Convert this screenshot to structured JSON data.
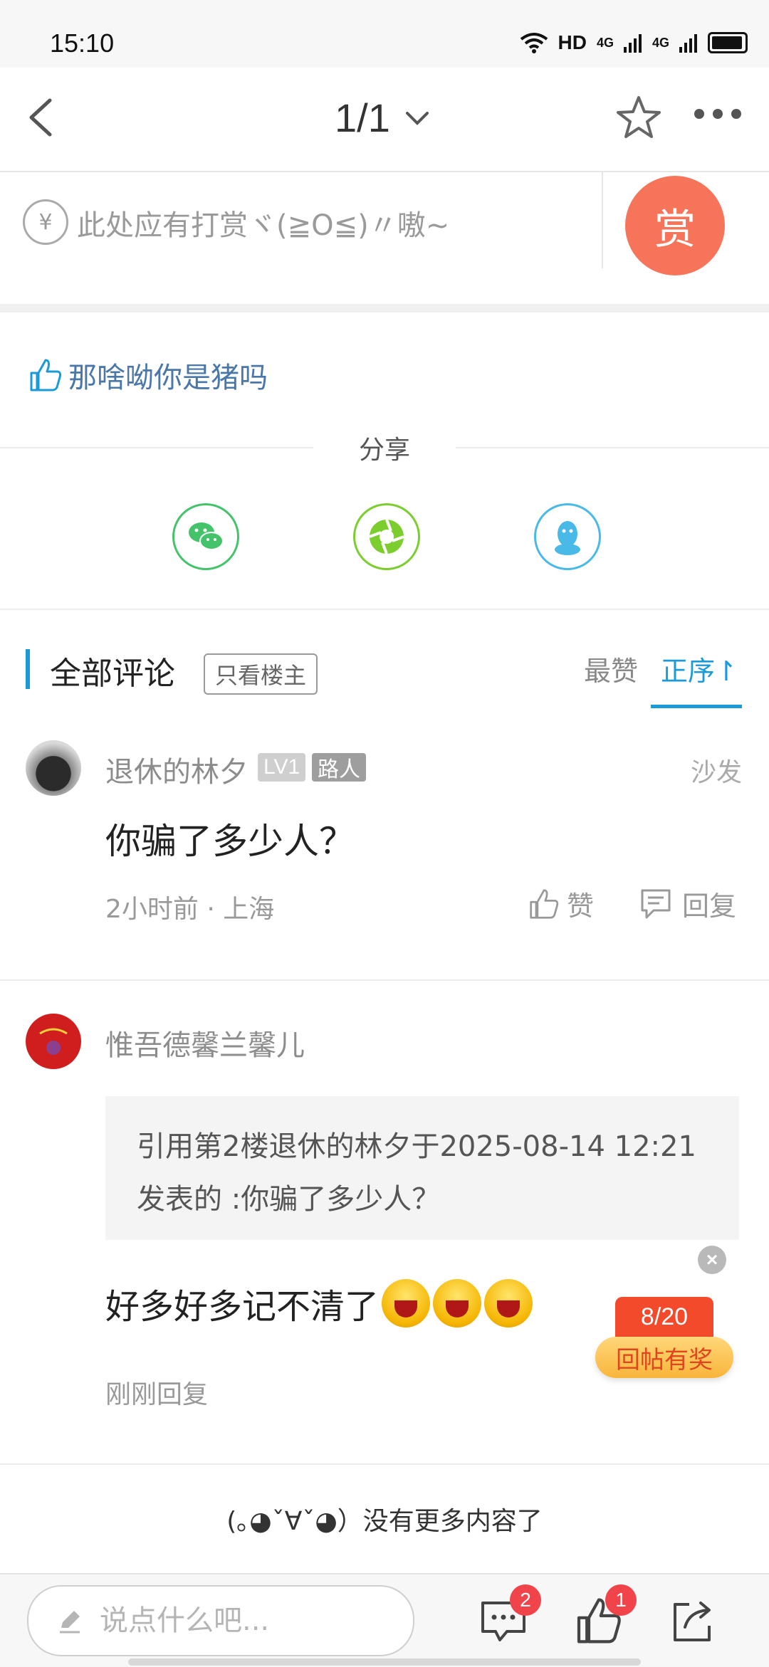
{
  "status_bar": {
    "time": "15:10",
    "network": "HD",
    "signal1": "4G",
    "signal2": "4G"
  },
  "top_nav": {
    "page_indicator": "1/1"
  },
  "reward": {
    "yen_symbol": "¥",
    "prompt": "此处应有打赏ヾ(≧O≦)〃嗷~",
    "button_label": "赏"
  },
  "likes": {
    "liked_by": "那啥呦你是猪吗"
  },
  "share": {
    "title": "分享",
    "targets": [
      "wechat-icon",
      "moments-icon",
      "qq-icon"
    ]
  },
  "comments_header": {
    "title": "全部评论",
    "owner_only": "只看楼主",
    "sort_hot": "最赞",
    "sort_asc": "正序↾"
  },
  "comments": [
    {
      "user": "退休的林夕",
      "level": "LV1",
      "role": "路人",
      "floor": "沙发",
      "text": "你骗了多少人？",
      "meta": "2小时前 · 上海",
      "like_label": "赞",
      "reply_label": "回复"
    },
    {
      "user": "惟吾德馨兰馨儿",
      "quote": "引用第2楼退休的林夕于2025-08-14 12:21发表的  :你骗了多少人？",
      "text": "好多好多记不清了",
      "time": "刚刚回复"
    }
  ],
  "float_reward": {
    "progress": "8/20",
    "label": "回帖有奖",
    "close": "×"
  },
  "no_more": "(｡◕ˇ∀ˇ◕）没有更多内容了",
  "bottom_bar": {
    "placeholder": "说点什么吧...",
    "comment_count": "2",
    "like_count": "1"
  },
  "colors": {
    "accent_blue": "#1a9bd7",
    "reward_orange": "#f6755a",
    "link_blue": "#4a77a8",
    "badge_red": "#f0444a"
  }
}
